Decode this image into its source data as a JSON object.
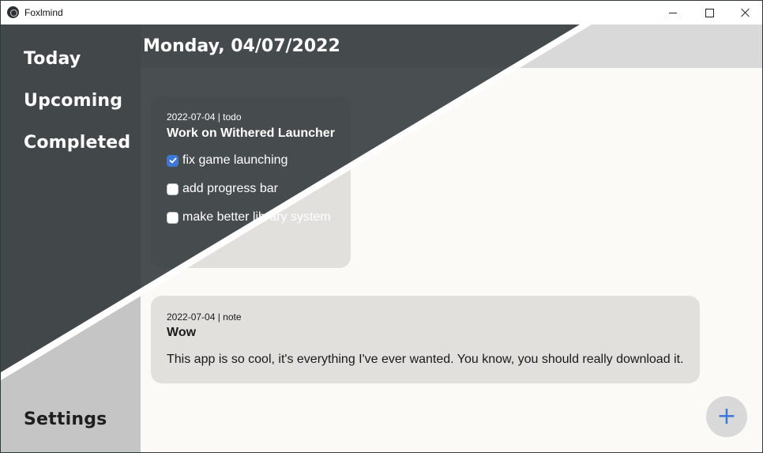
{
  "window": {
    "title": "Foxlmind",
    "icon": "foxlmind-app-icon",
    "controls": [
      "minimize-icon",
      "maximize-icon",
      "close-icon"
    ]
  },
  "sidebar": {
    "items": [
      {
        "label": "Today"
      },
      {
        "label": "Upcoming"
      },
      {
        "label": "Completed"
      }
    ],
    "settings_label": "Settings"
  },
  "header": {
    "date_title": "Monday, 04/07/2022"
  },
  "todo_card": {
    "meta": "2022-07-04 | todo",
    "title": "Work on Withered Launcher",
    "tasks": [
      {
        "label": "fix game launching",
        "checked": true
      },
      {
        "label": "add progress bar",
        "checked": false
      },
      {
        "label": "make better library system",
        "checked": false
      }
    ]
  },
  "note_card": {
    "meta": "2022-07-04 | note",
    "title": "Wow",
    "body": "This app is so cool, it's everything I've ever wanted. You know, you should really download it."
  },
  "fab": {
    "label": "+",
    "icon": "plus-icon"
  },
  "colors": {
    "dark_panel": "#3d4044",
    "accent": "#3b78d8",
    "background": "#fbfaf6",
    "card": "#e2e0dc"
  }
}
